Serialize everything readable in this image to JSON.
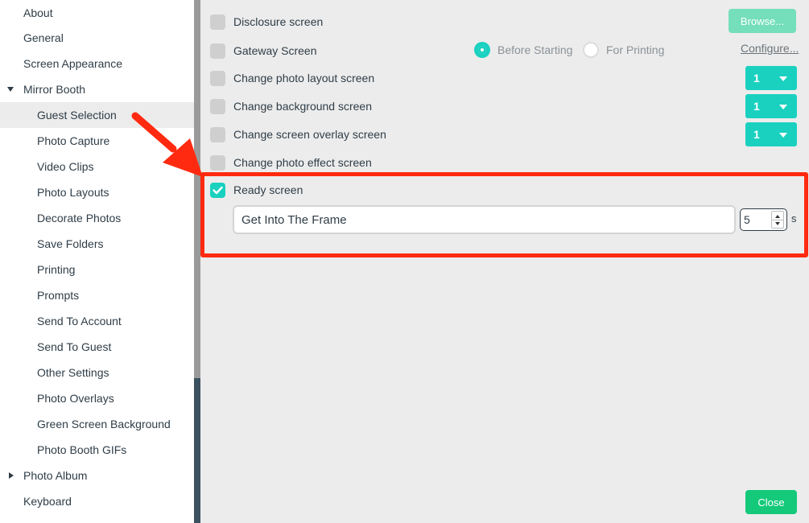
{
  "sidebar": {
    "items": [
      {
        "label": "About",
        "level": 0
      },
      {
        "label": "General",
        "level": 0
      },
      {
        "label": "Screen Appearance",
        "level": 0
      },
      {
        "label": "Mirror Booth",
        "level": 0,
        "expanded": true
      },
      {
        "label": "Guest Selection",
        "level": 1,
        "selected": true
      },
      {
        "label": "Photo Capture",
        "level": 1
      },
      {
        "label": "Video Clips",
        "level": 1
      },
      {
        "label": "Photo Layouts",
        "level": 1
      },
      {
        "label": "Decorate Photos",
        "level": 1
      },
      {
        "label": "Save Folders",
        "level": 1
      },
      {
        "label": "Printing",
        "level": 1
      },
      {
        "label": "Prompts",
        "level": 1
      },
      {
        "label": "Send To Account",
        "level": 1
      },
      {
        "label": "Send To Guest",
        "level": 1
      },
      {
        "label": "Other Settings",
        "level": 1
      },
      {
        "label": "Photo Overlays",
        "level": 1
      },
      {
        "label": "Green Screen Background",
        "level": 1
      },
      {
        "label": "Photo Booth GIFs",
        "level": 1
      },
      {
        "label": "Photo Album",
        "level": 0,
        "expanded": false
      },
      {
        "label": "Keyboard",
        "level": 0
      }
    ]
  },
  "main": {
    "disclosure": {
      "label": "Disclosure screen",
      "checked": false,
      "browse_label": "Browse..."
    },
    "gateway": {
      "label": "Gateway Screen",
      "checked": false,
      "radio_before": "Before Starting",
      "radio_printing": "For Printing",
      "selected_radio": "Before Starting",
      "configure_label": "Configure..."
    },
    "photo_layout": {
      "label": "Change photo layout screen",
      "checked": false,
      "value": "1"
    },
    "background": {
      "label": "Change background screen",
      "checked": false,
      "value": "1"
    },
    "overlay": {
      "label": "Change screen overlay screen",
      "checked": false,
      "value": "1"
    },
    "photo_effect": {
      "label": "Change photo effect screen",
      "checked": false
    },
    "ready": {
      "label": "Ready screen",
      "checked": true,
      "text_value": "Get Into The Frame",
      "seconds": "5",
      "unit": "s"
    },
    "close_label": "Close"
  },
  "colors": {
    "accent": "#1ad1c0",
    "close_button": "#14c97a",
    "browse_button": "#74dfba",
    "annotation": "#ff2a10",
    "panel_background": "#ececec"
  }
}
